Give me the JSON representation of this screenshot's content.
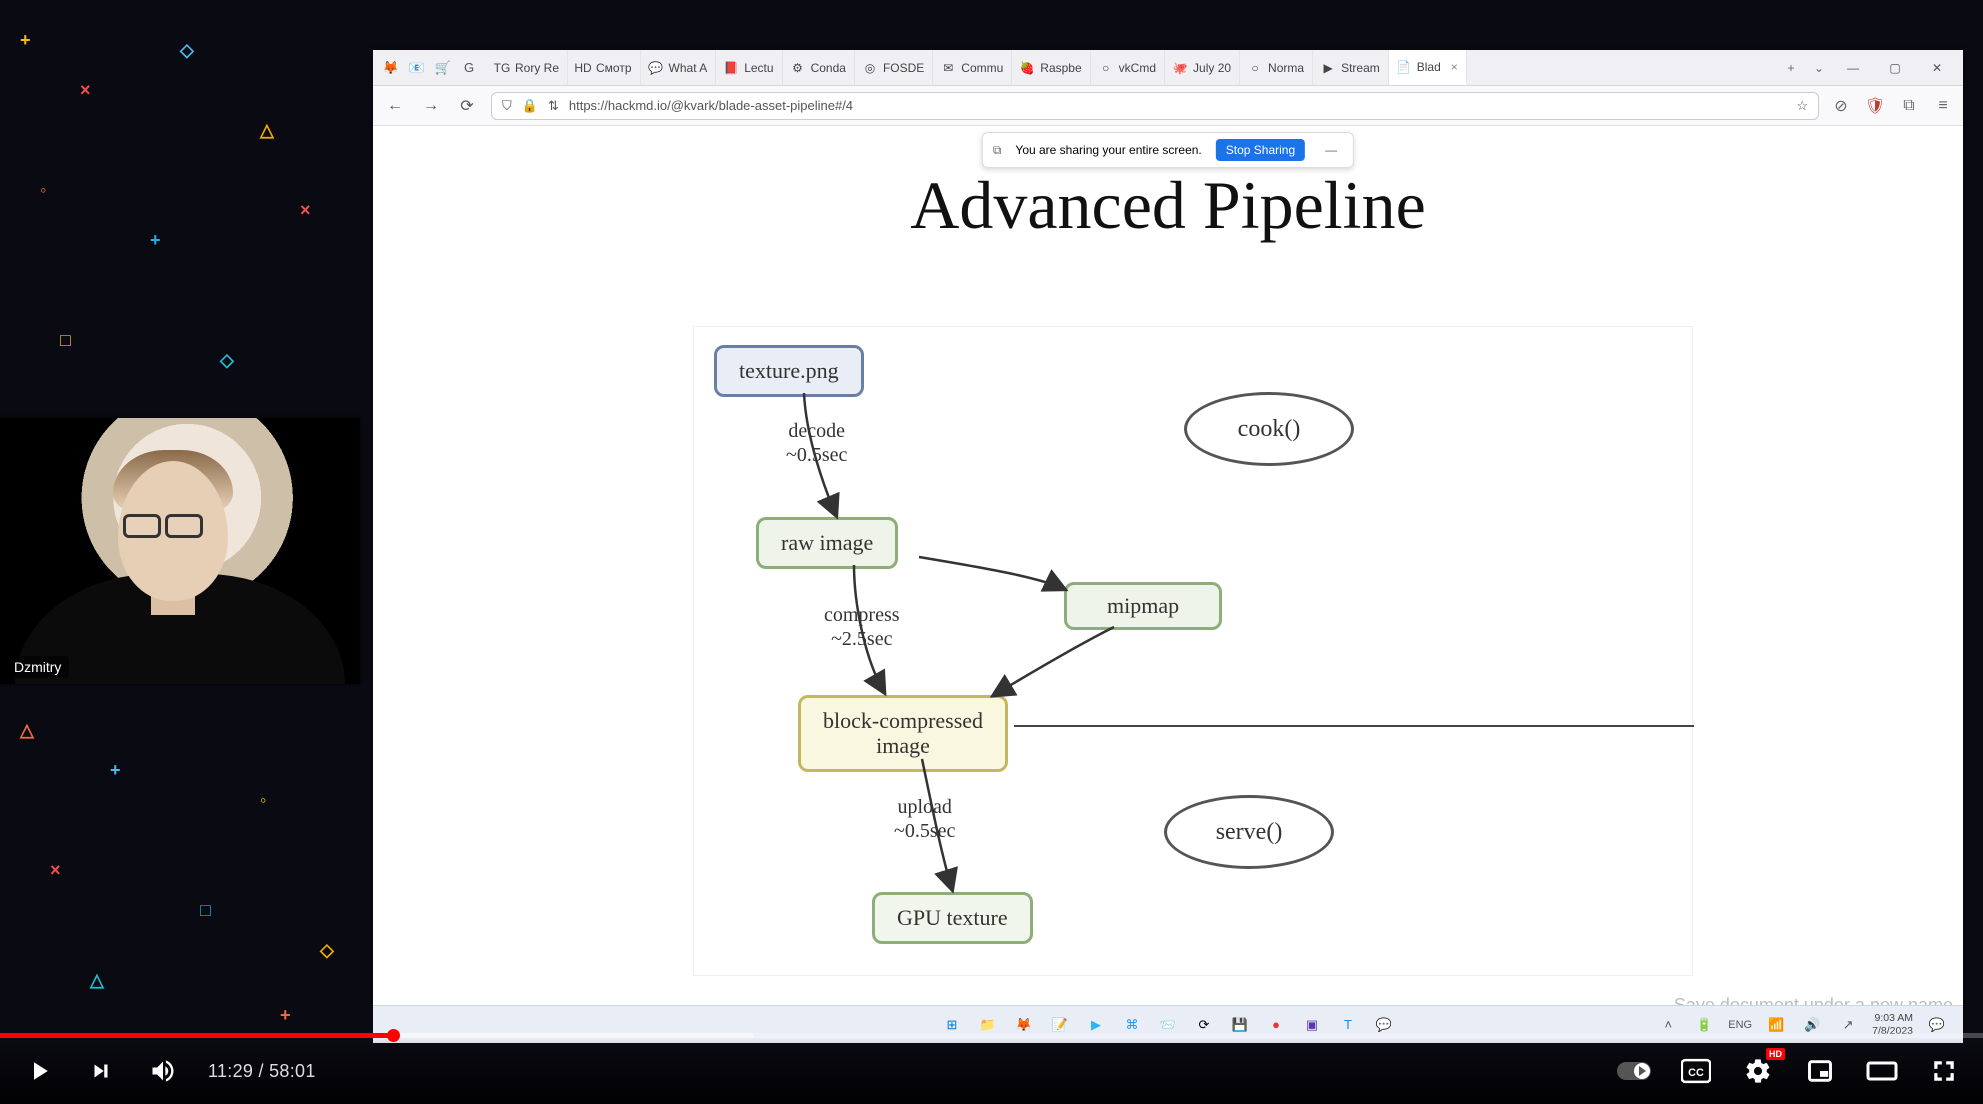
{
  "browser": {
    "pinned_icons": [
      "🦊",
      "📧",
      "🛒",
      "G"
    ],
    "tabs": [
      {
        "fav": "TG",
        "label": "Rory Re"
      },
      {
        "fav": "HD",
        "label": "Смотр"
      },
      {
        "fav": "💬",
        "label": "What A"
      },
      {
        "fav": "📕",
        "label": "Lectu"
      },
      {
        "fav": "⚙",
        "label": "Conda"
      },
      {
        "fav": "◎",
        "label": "FOSDE"
      },
      {
        "fav": "✉",
        "label": "Commu"
      },
      {
        "fav": "🍓",
        "label": "Raspbe"
      },
      {
        "fav": "○",
        "label": "vkCmd"
      },
      {
        "fav": "🐙",
        "label": "July 20"
      },
      {
        "fav": "○",
        "label": "Norma"
      },
      {
        "fav": "▶",
        "label": "Stream"
      },
      {
        "fav": "📄",
        "label": "Blad",
        "active": true,
        "close": true
      }
    ],
    "newtab": "+",
    "dropdown": "⌄",
    "win": {
      "min": "—",
      "max": "▢",
      "close": "✕"
    },
    "nav": {
      "back": "←",
      "fwd": "→",
      "reload": "⟳"
    },
    "shield": "⛉",
    "lock": "🔒",
    "perm": "⇅",
    "url": "https://hackmd.io/@kvark/blade-asset-pipeline#/4",
    "star": "☆",
    "right_icons": [
      "⊘",
      "🛡",
      "⧉",
      "≡"
    ]
  },
  "sharebar": {
    "icon": "⧉",
    "msg": "You are sharing your entire screen.",
    "stop": "Stop Sharing",
    "min": "—"
  },
  "slide": {
    "title": "Advanced Pipeline",
    "boxes": {
      "texture": "texture.png",
      "raw": "raw image",
      "mip": "mipmap",
      "blk_l1": "block-compressed",
      "blk_l2": "image",
      "gpu": "GPU texture"
    },
    "labels": {
      "decode_l1": "decode",
      "decode_l2": "~0.5sec",
      "compress_l1": "compress",
      "compress_l2": "~2.5sec",
      "upload_l1": "upload",
      "upload_l2": "~0.5sec"
    },
    "ellipses": {
      "cook": "cook()",
      "serve": "serve()"
    },
    "watermark": "Save document under a new name",
    "nav_left": "‹",
    "nav_right": "›"
  },
  "webcam": {
    "name": "Dzmitry"
  },
  "taskbar": {
    "center_icons": [
      "⊞",
      "📁",
      "🦊",
      "📝",
      "▶",
      "⌘",
      "📨",
      "⟳",
      "💾",
      "●",
      "▣",
      "T",
      "💬"
    ],
    "right_icons": [
      "˄",
      "🔋",
      "ENG",
      "📶",
      "🔊",
      "↗"
    ],
    "time": "9:03 AM",
    "date": "7/8/2023",
    "bell": "💬"
  },
  "youtube": {
    "time_current": "11:29",
    "time_sep": " / ",
    "time_total": "58:01",
    "hd": "HD"
  }
}
